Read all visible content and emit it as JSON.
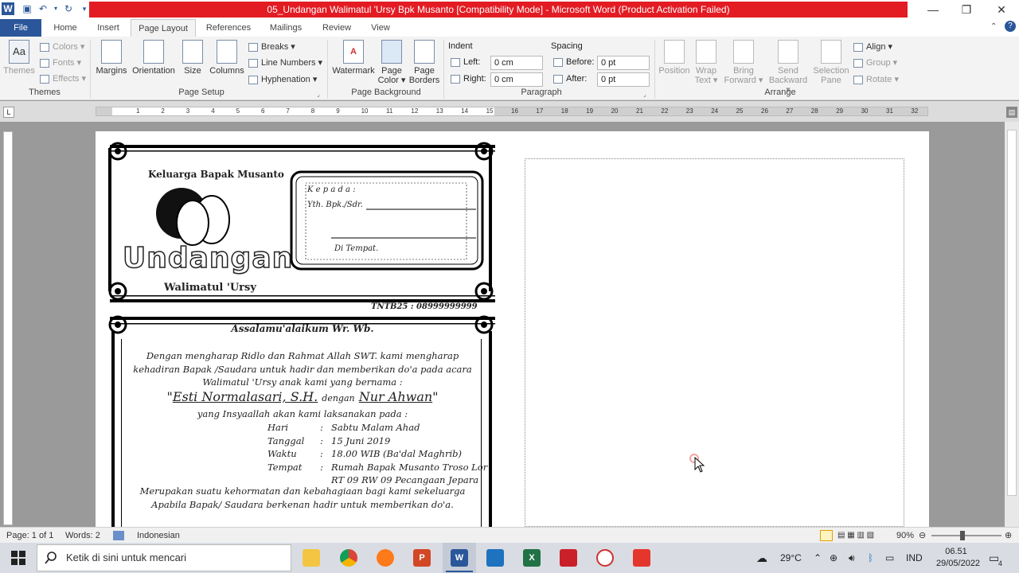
{
  "window": {
    "title": "05_Undangan Walimatul 'Ursy Bpk Musanto [Compatibility Mode] - Microsoft Word (Product Activation Failed)",
    "accent": "#2b579a",
    "title_bg": "#e31b23"
  },
  "tabs": [
    "File",
    "Home",
    "Insert",
    "Page Layout",
    "References",
    "Mailings",
    "Review",
    "View"
  ],
  "ribbon": {
    "themes": {
      "big": "Themes",
      "colors": "Colors",
      "fonts": "Fonts",
      "effects": "Effects",
      "group": "Themes"
    },
    "page_setup": {
      "margins": "Margins",
      "orientation": "Orientation",
      "size": "Size",
      "columns": "Columns",
      "breaks": "Breaks",
      "line_numbers": "Line Numbers",
      "hyphenation": "Hyphenation",
      "group": "Page Setup"
    },
    "page_background": {
      "watermark": "Watermark",
      "page_color_1": "Page",
      "page_color_2": "Color",
      "page_borders_1": "Page",
      "page_borders_2": "Borders",
      "group": "Page Background"
    },
    "paragraph": {
      "indent": "Indent",
      "left": "Left:",
      "left_val": "0 cm",
      "right": "Right:",
      "right_val": "0 cm",
      "spacing": "Spacing",
      "before": "Before:",
      "before_val": "0 pt",
      "after": "After:",
      "after_val": "0 pt",
      "group": "Paragraph"
    },
    "arrange": {
      "position": "Position",
      "wrap_1": "Wrap",
      "wrap_2": "Text",
      "bring_1": "Bring",
      "bring_2": "Forward",
      "send_1": "Send",
      "send_2": "Backward",
      "selection_1": "Selection",
      "selection_2": "Pane",
      "align": "Align",
      "group_btn": "Group",
      "rotate": "Rotate",
      "group": "Arrange"
    }
  },
  "ruler_numbers": [
    "1",
    "2",
    "3",
    "4",
    "5",
    "6",
    "7",
    "8",
    "9",
    "10",
    "11",
    "12",
    "13",
    "14",
    "15",
    "16",
    "17",
    "18",
    "19",
    "20",
    "21",
    "22",
    "23",
    "24",
    "25",
    "26",
    "27",
    "28",
    "29",
    "30",
    "31",
    "32"
  ],
  "document": {
    "family": "Keluarga  Bapak Musanto",
    "title_big": "Undangan",
    "subtitle": "Walimatul 'Ursy",
    "kepada": "K e p a d a   :",
    "yth": "Yth. Bpk./Sdr.",
    "di_tempat": "Di Tempat.",
    "tnb": "TNTB25 : 08999999999",
    "salam": "Assalamu'alaikum Wr. Wb.",
    "p1": "Dengan mengharap Ridlo dan Rahmat Allah SWT. kami mengharap",
    "p2": "kehadiran  Bapak /Saudara untuk hadir dan memberikan do'a pada acara",
    "p3": "Walimatul 'Ursy anak kami yang bernama :",
    "bride": "Esti Normalasari, S.H.",
    "dengan": "dengan",
    "groom": "Nur Ahwan",
    "p4": "yang Insyaallah akan kami laksanakan pada :",
    "details": [
      {
        "k": "Hari",
        "v": "Sabtu Malam Ahad"
      },
      {
        "k": "Tanggal",
        "v": "15 Juni 2019"
      },
      {
        "k": "Waktu",
        "v": "18.00 WIB (Ba'dal Maghrib)"
      },
      {
        "k": "Tempat",
        "v": "Rumah Bapak Musanto Troso Lor"
      }
    ],
    "address2": "RT 09  RW 09 Pecangaan Jepara",
    "p5": "Merupakan suatu kehormatan dan kebahagiaan bagi kami sekeluarga",
    "p6": "Apabila Bapak/ Saudara berkenan hadir untuk memberikan do'a."
  },
  "status": {
    "page": "Page: 1 of 1",
    "words": "Words: 2",
    "language": "Indonesian",
    "zoom": "90%"
  },
  "taskbar": {
    "search_placeholder": "Ketik di sini untuk mencari",
    "temp": "29°C",
    "lang": "IND",
    "time": "06.51",
    "date": "29/05/2022",
    "notif": "4"
  }
}
